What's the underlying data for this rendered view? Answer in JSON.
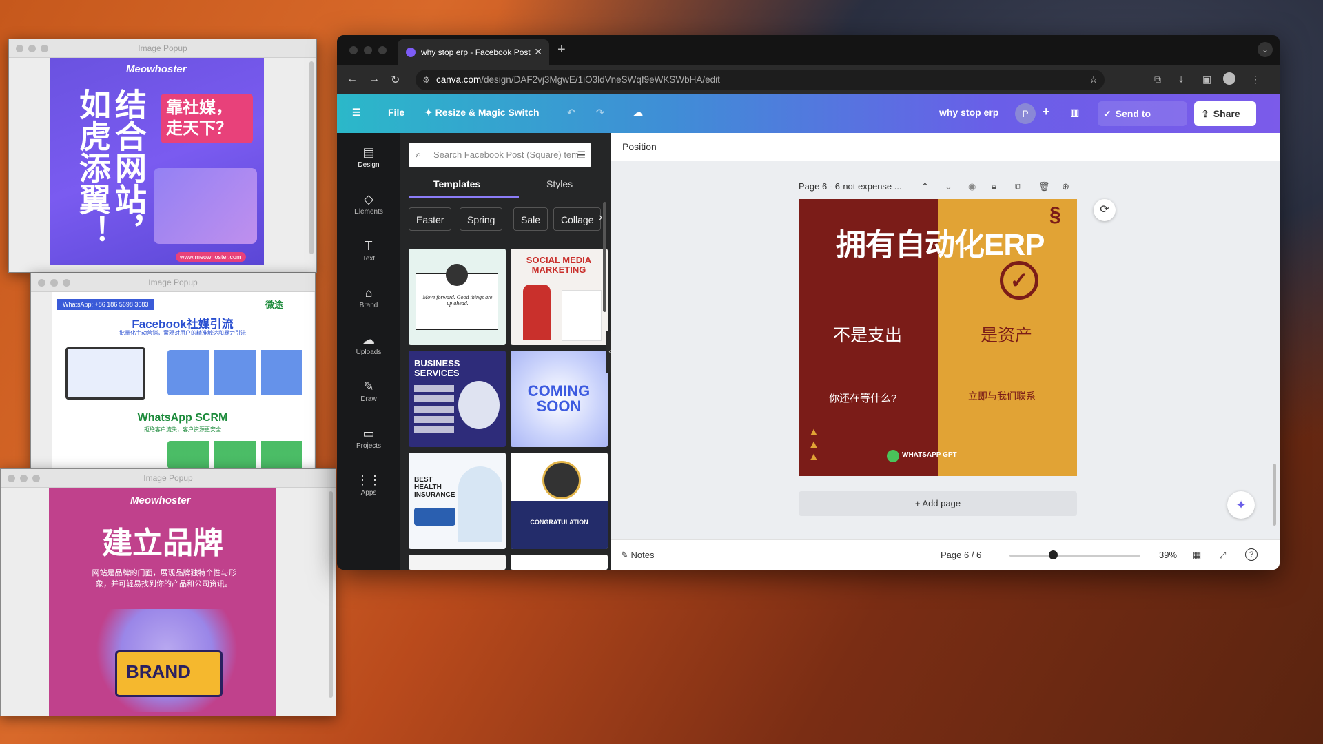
{
  "popups": [
    {
      "title": "Image Popup",
      "brand": "Meowhoster",
      "headline": "结合网站，如虎添翼！",
      "bubble": "靠社媒，走天下？",
      "url": "www.meowhoster.com"
    },
    {
      "title": "Image Popup",
      "whatsapp": "WhatsApp: +86 186 5698 3683",
      "logo": "微途",
      "heading1": "Facebook社媒引流",
      "sub1": "批量化主动营销，實現对用户的精准触达和暴力引流",
      "heading2": "WhatsApp SCRM",
      "sub2": "拒绝客户流失，客户资源更安全"
    },
    {
      "title": "Image Popup",
      "brand": "Meowhoster",
      "headline": "建立品牌",
      "body": "网站是品牌的门面，展现品牌独特个性与形象，并可轻易找到你的产品和公司资讯。",
      "illustration_text": "BRAND"
    }
  ],
  "browser": {
    "tab_title": "why stop erp - Facebook Post",
    "url_domain": "canva.com",
    "url_path": "/design/DAF2vj3MgwE/1iO3ldVneSWqf9eWKSWbHA/edit"
  },
  "canva": {
    "file_label": "File",
    "resize_label": "Resize & Magic Switch",
    "doc_title": "why stop erp",
    "avatar_letter": "P",
    "send_label": "Send to Teacher",
    "share_label": "Share",
    "rail": [
      {
        "label": "Design",
        "icon": "design-icon"
      },
      {
        "label": "Elements",
        "icon": "elements-icon"
      },
      {
        "label": "Text",
        "icon": "text-icon"
      },
      {
        "label": "Brand",
        "icon": "brand-icon"
      },
      {
        "label": "Uploads",
        "icon": "uploads-icon"
      },
      {
        "label": "Draw",
        "icon": "draw-icon"
      },
      {
        "label": "Projects",
        "icon": "projects-icon"
      },
      {
        "label": "Apps",
        "icon": "apps-icon"
      }
    ],
    "search_placeholder": "Search Facebook Post (Square) templates",
    "panel_tabs": [
      "Templates",
      "Styles"
    ],
    "chips": [
      "Easter",
      "Spring",
      "Sale",
      "Collage"
    ],
    "templates": [
      {
        "name": "quote",
        "text": "Move forward. Good things are up ahead."
      },
      {
        "name": "social-media-marketing",
        "text": "SOCIAL MEDIA MARKETING"
      },
      {
        "name": "business-services",
        "text": "BUSINESS SERVICES"
      },
      {
        "name": "coming-soon",
        "text": "COMING SOON"
      },
      {
        "name": "health-insurance",
        "text": "BEST HEALTH INSURANCE"
      },
      {
        "name": "congratulation",
        "text": "CONGRATULATION"
      }
    ],
    "position_label": "Position",
    "page_label": "Page 6 - 6-not expense ...",
    "design": {
      "title": "拥有自动化ERP",
      "left_text": "不是支出",
      "right_text": "是资产",
      "left_sub": "你还在等什么?",
      "right_sub": "立即与我们联系",
      "badge": "WHATSAPP GPT",
      "colors": {
        "left": "#7b1c18",
        "right": "#e1a335"
      }
    },
    "add_page_label": "+ Add page",
    "notes_label": "Notes",
    "page_count": "Page 6 / 6",
    "zoom": "39%",
    "zoom_level": 0.39
  }
}
